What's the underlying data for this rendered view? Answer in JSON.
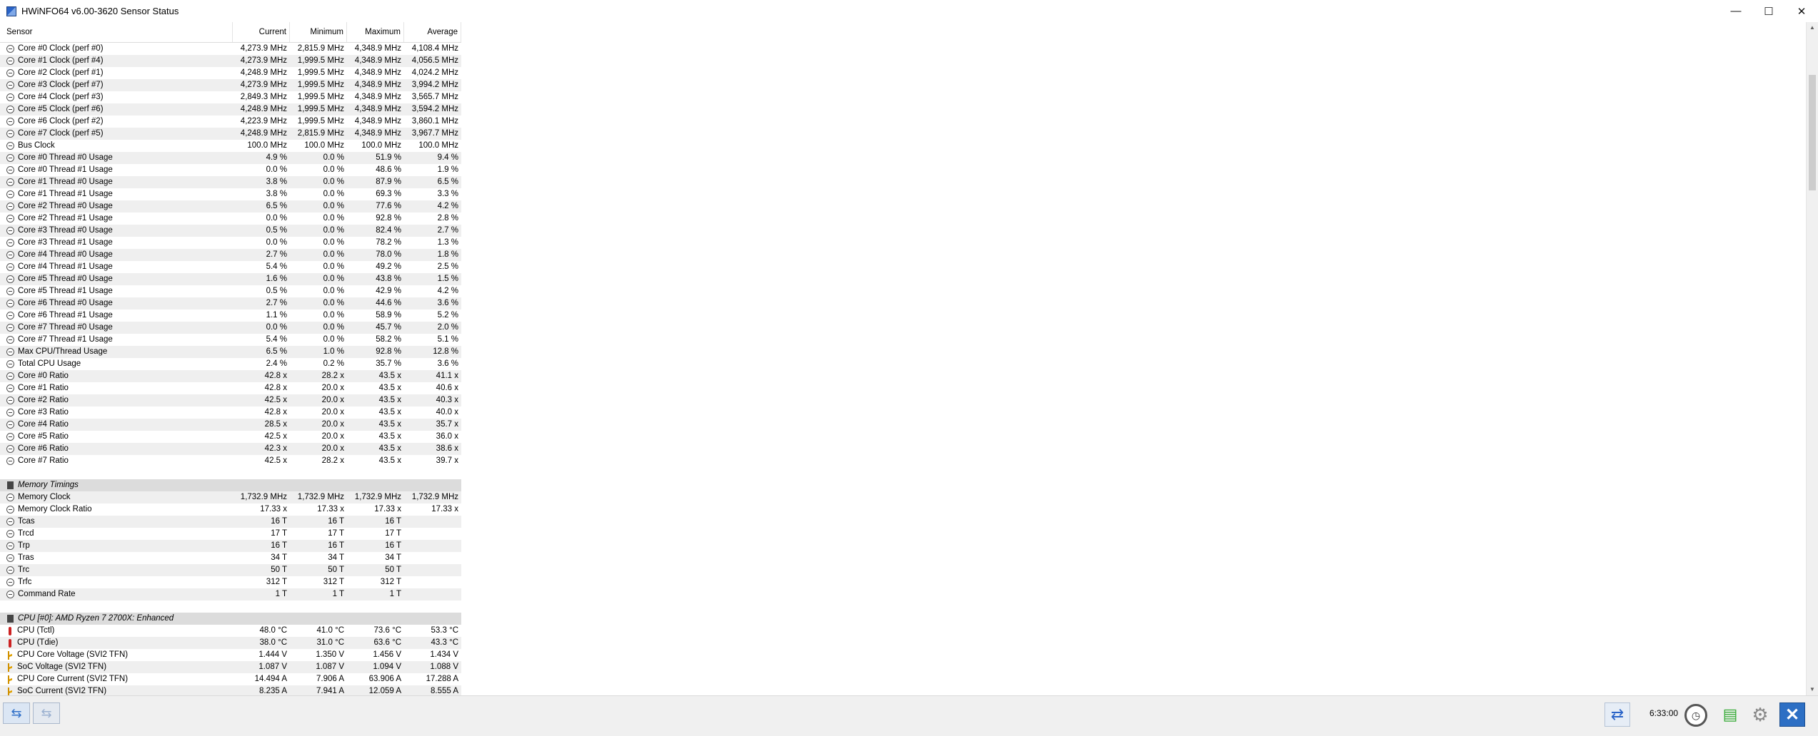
{
  "window": {
    "title": "HWiNFO64 v6.00-3620 Sensor Status",
    "minimize": "—",
    "maximize": "☐",
    "close": "✕"
  },
  "columns": {
    "sensor": "Sensor",
    "current": "Current",
    "minimum": "Minimum",
    "maximum": "Maximum",
    "average": "Average"
  },
  "rows": [
    {
      "type": "sensor",
      "icon": "clock",
      "name": "Core #0 Clock (perf #0)",
      "cur": "4,273.9 MHz",
      "min": "2,815.9 MHz",
      "max": "4,348.9 MHz",
      "avg": "4,108.4 MHz"
    },
    {
      "type": "sensor",
      "icon": "clock",
      "name": "Core #1 Clock (perf #4)",
      "cur": "4,273.9 MHz",
      "min": "1,999.5 MHz",
      "max": "4,348.9 MHz",
      "avg": "4,056.5 MHz"
    },
    {
      "type": "sensor",
      "icon": "clock",
      "name": "Core #2 Clock (perf #1)",
      "cur": "4,248.9 MHz",
      "min": "1,999.5 MHz",
      "max": "4,348.9 MHz",
      "avg": "4,024.2 MHz"
    },
    {
      "type": "sensor",
      "icon": "clock",
      "name": "Core #3 Clock (perf #7)",
      "cur": "4,273.9 MHz",
      "min": "1,999.5 MHz",
      "max": "4,348.9 MHz",
      "avg": "3,994.2 MHz"
    },
    {
      "type": "sensor",
      "icon": "clock",
      "name": "Core #4 Clock (perf #3)",
      "cur": "2,849.3 MHz",
      "min": "1,999.5 MHz",
      "max": "4,348.9 MHz",
      "avg": "3,565.7 MHz"
    },
    {
      "type": "sensor",
      "icon": "clock",
      "name": "Core #5 Clock (perf #6)",
      "cur": "4,248.9 MHz",
      "min": "1,999.5 MHz",
      "max": "4,348.9 MHz",
      "avg": "3,594.2 MHz"
    },
    {
      "type": "sensor",
      "icon": "clock",
      "name": "Core #6 Clock (perf #2)",
      "cur": "4,223.9 MHz",
      "min": "1,999.5 MHz",
      "max": "4,348.9 MHz",
      "avg": "3,860.1 MHz"
    },
    {
      "type": "sensor",
      "icon": "clock",
      "name": "Core #7 Clock (perf #5)",
      "cur": "4,248.9 MHz",
      "min": "2,815.9 MHz",
      "max": "4,348.9 MHz",
      "avg": "3,967.7 MHz"
    },
    {
      "type": "sensor",
      "icon": "clock",
      "name": "Bus Clock",
      "cur": "100.0 MHz",
      "min": "100.0 MHz",
      "max": "100.0 MHz",
      "avg": "100.0 MHz"
    },
    {
      "type": "sensor",
      "icon": "clock",
      "name": "Core #0 Thread #0 Usage",
      "cur": "4.9 %",
      "min": "0.0 %",
      "max": "51.9 %",
      "avg": "9.4 %"
    },
    {
      "type": "sensor",
      "icon": "clock",
      "name": "Core #0 Thread #1 Usage",
      "cur": "0.0 %",
      "min": "0.0 %",
      "max": "48.6 %",
      "avg": "1.9 %"
    },
    {
      "type": "sensor",
      "icon": "clock",
      "name": "Core #1 Thread #0 Usage",
      "cur": "3.8 %",
      "min": "0.0 %",
      "max": "87.9 %",
      "avg": "6.5 %"
    },
    {
      "type": "sensor",
      "icon": "clock",
      "name": "Core #1 Thread #1 Usage",
      "cur": "3.8 %",
      "min": "0.0 %",
      "max": "69.3 %",
      "avg": "3.3 %"
    },
    {
      "type": "sensor",
      "icon": "clock",
      "name": "Core #2 Thread #0 Usage",
      "cur": "6.5 %",
      "min": "0.0 %",
      "max": "77.6 %",
      "avg": "4.2 %"
    },
    {
      "type": "sensor",
      "icon": "clock",
      "name": "Core #2 Thread #1 Usage",
      "cur": "0.0 %",
      "min": "0.0 %",
      "max": "92.8 %",
      "avg": "2.8 %"
    },
    {
      "type": "sensor",
      "icon": "clock",
      "name": "Core #3 Thread #0 Usage",
      "cur": "0.5 %",
      "min": "0.0 %",
      "max": "82.4 %",
      "avg": "2.7 %"
    },
    {
      "type": "sensor",
      "icon": "clock",
      "name": "Core #3 Thread #1 Usage",
      "cur": "0.0 %",
      "min": "0.0 %",
      "max": "78.2 %",
      "avg": "1.3 %"
    },
    {
      "type": "sensor",
      "icon": "clock",
      "name": "Core #4 Thread #0 Usage",
      "cur": "2.7 %",
      "min": "0.0 %",
      "max": "78.0 %",
      "avg": "1.8 %"
    },
    {
      "type": "sensor",
      "icon": "clock",
      "name": "Core #4 Thread #1 Usage",
      "cur": "5.4 %",
      "min": "0.0 %",
      "max": "49.2 %",
      "avg": "2.5 %"
    },
    {
      "type": "sensor",
      "icon": "clock",
      "name": "Core #5 Thread #0 Usage",
      "cur": "1.6 %",
      "min": "0.0 %",
      "max": "43.8 %",
      "avg": "1.5 %"
    },
    {
      "type": "sensor",
      "icon": "clock",
      "name": "Core #5 Thread #1 Usage",
      "cur": "0.5 %",
      "min": "0.0 %",
      "max": "42.9 %",
      "avg": "4.2 %"
    },
    {
      "type": "sensor",
      "icon": "clock",
      "name": "Core #6 Thread #0 Usage",
      "cur": "2.7 %",
      "min": "0.0 %",
      "max": "44.6 %",
      "avg": "3.6 %"
    },
    {
      "type": "sensor",
      "icon": "clock",
      "name": "Core #6 Thread #1 Usage",
      "cur": "1.1 %",
      "min": "0.0 %",
      "max": "58.9 %",
      "avg": "5.2 %"
    },
    {
      "type": "sensor",
      "icon": "clock",
      "name": "Core #7 Thread #0 Usage",
      "cur": "0.0 %",
      "min": "0.0 %",
      "max": "45.7 %",
      "avg": "2.0 %"
    },
    {
      "type": "sensor",
      "icon": "clock",
      "name": "Core #7 Thread #1 Usage",
      "cur": "5.4 %",
      "min": "0.0 %",
      "max": "58.2 %",
      "avg": "5.1 %"
    },
    {
      "type": "sensor",
      "icon": "clock",
      "name": "Max CPU/Thread Usage",
      "cur": "6.5 %",
      "min": "1.0 %",
      "max": "92.8 %",
      "avg": "12.8 %"
    },
    {
      "type": "sensor",
      "icon": "clock",
      "name": "Total CPU Usage",
      "cur": "2.4 %",
      "min": "0.2 %",
      "max": "35.7 %",
      "avg": "3.6 %"
    },
    {
      "type": "sensor",
      "icon": "clock",
      "name": "Core #0 Ratio",
      "cur": "42.8 x",
      "min": "28.2 x",
      "max": "43.5 x",
      "avg": "41.1 x"
    },
    {
      "type": "sensor",
      "icon": "clock",
      "name": "Core #1 Ratio",
      "cur": "42.8 x",
      "min": "20.0 x",
      "max": "43.5 x",
      "avg": "40.6 x"
    },
    {
      "type": "sensor",
      "icon": "clock",
      "name": "Core #2 Ratio",
      "cur": "42.5 x",
      "min": "20.0 x",
      "max": "43.5 x",
      "avg": "40.3 x"
    },
    {
      "type": "sensor",
      "icon": "clock",
      "name": "Core #3 Ratio",
      "cur": "42.8 x",
      "min": "20.0 x",
      "max": "43.5 x",
      "avg": "40.0 x"
    },
    {
      "type": "sensor",
      "icon": "clock",
      "name": "Core #4 Ratio",
      "cur": "28.5 x",
      "min": "20.0 x",
      "max": "43.5 x",
      "avg": "35.7 x"
    },
    {
      "type": "sensor",
      "icon": "clock",
      "name": "Core #5 Ratio",
      "cur": "42.5 x",
      "min": "20.0 x",
      "max": "43.5 x",
      "avg": "36.0 x"
    },
    {
      "type": "sensor",
      "icon": "clock",
      "name": "Core #6 Ratio",
      "cur": "42.3 x",
      "min": "20.0 x",
      "max": "43.5 x",
      "avg": "38.6 x"
    },
    {
      "type": "sensor",
      "icon": "clock",
      "name": "Core #7 Ratio",
      "cur": "42.5 x",
      "min": "28.2 x",
      "max": "43.5 x",
      "avg": "39.7 x"
    },
    {
      "type": "blank"
    },
    {
      "type": "group",
      "icon": "chip",
      "name": "Memory Timings"
    },
    {
      "type": "sensor",
      "icon": "clock",
      "name": "Memory Clock",
      "cur": "1,732.9 MHz",
      "min": "1,732.9 MHz",
      "max": "1,732.9 MHz",
      "avg": "1,732.9 MHz"
    },
    {
      "type": "sensor",
      "icon": "clock",
      "name": "Memory Clock Ratio",
      "cur": "17.33 x",
      "min": "17.33 x",
      "max": "17.33 x",
      "avg": "17.33 x"
    },
    {
      "type": "sensor",
      "icon": "clock",
      "name": "Tcas",
      "cur": "16 T",
      "min": "16 T",
      "max": "16 T",
      "avg": ""
    },
    {
      "type": "sensor",
      "icon": "clock",
      "name": "Trcd",
      "cur": "17 T",
      "min": "17 T",
      "max": "17 T",
      "avg": ""
    },
    {
      "type": "sensor",
      "icon": "clock",
      "name": "Trp",
      "cur": "16 T",
      "min": "16 T",
      "max": "16 T",
      "avg": ""
    },
    {
      "type": "sensor",
      "icon": "clock",
      "name": "Tras",
      "cur": "34 T",
      "min": "34 T",
      "max": "34 T",
      "avg": ""
    },
    {
      "type": "sensor",
      "icon": "clock",
      "name": "Trc",
      "cur": "50 T",
      "min": "50 T",
      "max": "50 T",
      "avg": ""
    },
    {
      "type": "sensor",
      "icon": "clock",
      "name": "Trfc",
      "cur": "312 T",
      "min": "312 T",
      "max": "312 T",
      "avg": ""
    },
    {
      "type": "sensor",
      "icon": "clock",
      "name": "Command Rate",
      "cur": "1 T",
      "min": "1 T",
      "max": "1 T",
      "avg": ""
    },
    {
      "type": "blank"
    },
    {
      "type": "group",
      "icon": "chip",
      "name": "CPU [#0]: AMD Ryzen 7 2700X: Enhanced"
    },
    {
      "type": "sensor",
      "icon": "therm",
      "name": "CPU (Tctl)",
      "cur": "48.0 °C",
      "min": "41.0 °C",
      "max": "73.6 °C",
      "avg": "53.3 °C"
    },
    {
      "type": "sensor",
      "icon": "therm",
      "name": "CPU (Tdie)",
      "cur": "38.0 °C",
      "min": "31.0 °C",
      "max": "63.6 °C",
      "avg": "43.3 °C"
    },
    {
      "type": "sensor",
      "icon": "volt",
      "name": "CPU Core Voltage (SVI2 TFN)",
      "cur": "1.444 V",
      "min": "1.350 V",
      "max": "1.456 V",
      "avg": "1.434 V"
    },
    {
      "type": "sensor",
      "icon": "volt",
      "name": "SoC Voltage (SVI2 TFN)",
      "cur": "1.087 V",
      "min": "1.087 V",
      "max": "1.094 V",
      "avg": "1.088 V"
    },
    {
      "type": "sensor",
      "icon": "volt",
      "name": "CPU Core Current (SVI2 TFN)",
      "cur": "14.494 A",
      "min": "7.906 A",
      "max": "63.906 A",
      "avg": "17.288 A"
    },
    {
      "type": "sensor",
      "icon": "volt",
      "name": "SoC Current (SVI2 TFN)",
      "cur": "8.235 A",
      "min": "7.941 A",
      "max": "12.059 A",
      "avg": "8.555 A"
    }
  ],
  "statusbar": {
    "nav_forward_label": "⇆",
    "nav_back_label": "⇆",
    "time": "6:33:00",
    "refresh_icon": "⇄",
    "clock_icon": "◷",
    "log_icon": "▤",
    "settings_icon": "⚙",
    "close_icon": "✕"
  }
}
